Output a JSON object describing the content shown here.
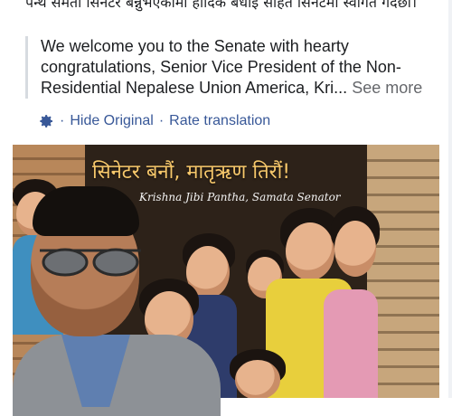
{
  "post": {
    "original_text": "पन्थ समता सिनेटर बन्नुभएकोमा हार्दिक बधाई सहित सिनेटमा स्वागत गर्दछौं।",
    "translation_text": "We welcome you to the Senate with hearty congratulations, Senior Vice President of the Non-Residential Nepalese Union America, Kri...",
    "see_more_label": "See more"
  },
  "translation_actions": {
    "gear_icon": "gear-icon",
    "separator": "·",
    "hide_original_label": "Hide Original",
    "rate_translation_label": "Rate translation",
    "link_color": "#385898"
  },
  "photo": {
    "banner_title": "सिनेटर बनौं, मातृऋण तिरौं!",
    "banner_subtitle": "Krishna Jibi Pantha, Samata Senator"
  }
}
